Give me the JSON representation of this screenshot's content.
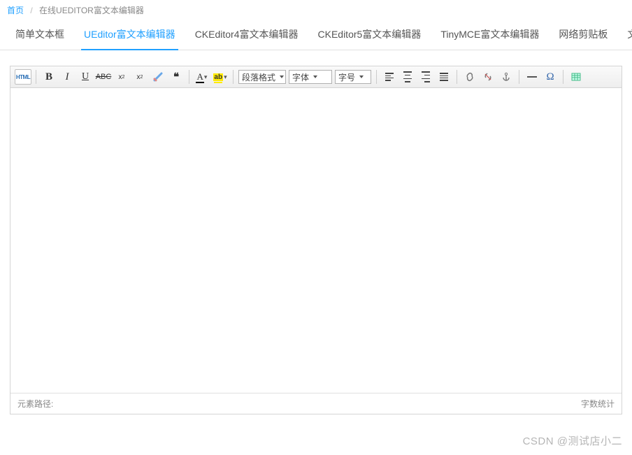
{
  "breadcrumb": {
    "home": "首页",
    "current": "在线UEDITOR富文本编辑器"
  },
  "tabs": [
    {
      "label": "简单文本框",
      "active": false
    },
    {
      "label": "UEditor富文本编辑器",
      "active": true
    },
    {
      "label": "CKEditor4富文本编辑器",
      "active": false
    },
    {
      "label": "CKEditor5富文本编辑器",
      "active": false
    },
    {
      "label": "TinyMCE富文本编辑器",
      "active": false
    },
    {
      "label": "网络剪贴板",
      "active": false
    },
    {
      "label": "文本派-极",
      "active": false
    }
  ],
  "toolbar": {
    "source_label": "HTML",
    "paragraph": "段落格式",
    "fontfamily": "字体",
    "fontsize": "字号"
  },
  "footer": {
    "elementPath": "元素路径:",
    "wordCount": "字数统计"
  },
  "watermark": "CSDN @测试店小二"
}
